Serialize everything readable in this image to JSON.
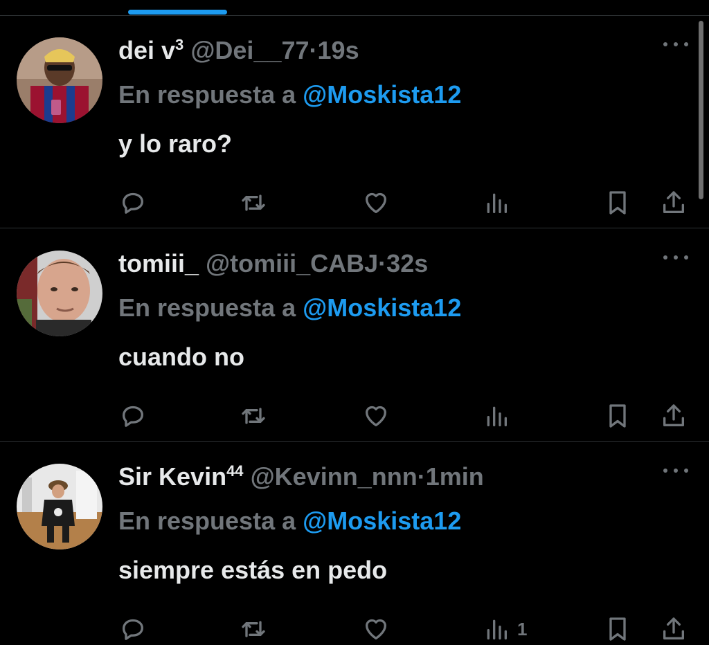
{
  "tabs": {
    "active_indicator_color": "#1d9bf0"
  },
  "colors": {
    "background": "#000000",
    "text": "#e7e9ea",
    "muted": "#71767b",
    "link": "#1d9bf0"
  },
  "replies": [
    {
      "display_name": "dei v",
      "badge": "3",
      "handle": "@Dei__77",
      "dot": "·",
      "time": "19s",
      "reply_prefix": "En respuesta a",
      "reply_to": "@Moskista12",
      "text": "y lo raro?",
      "views": "",
      "avatar_icon": "avatar-photo"
    },
    {
      "display_name": "tomiii_",
      "badge": "",
      "handle": "@tomiii_CABJ",
      "dot": "·",
      "time": "32s",
      "reply_prefix": "En respuesta a",
      "reply_to": "@Moskista12",
      "text": "cuando no",
      "views": "",
      "avatar_icon": "avatar-photo"
    },
    {
      "display_name": "Sir Kevin",
      "badge": "44",
      "handle": "@Kevinn_nnn",
      "dot": "·",
      "time": "1min",
      "reply_prefix": "En respuesta a",
      "reply_to": "@Moskista12",
      "text": "siempre estás en pedo",
      "views": "1",
      "avatar_icon": "avatar-photo"
    }
  ],
  "action_icons": [
    "reply-icon",
    "retweet-icon",
    "like-icon",
    "views-icon",
    "bookmark-icon",
    "share-icon"
  ]
}
